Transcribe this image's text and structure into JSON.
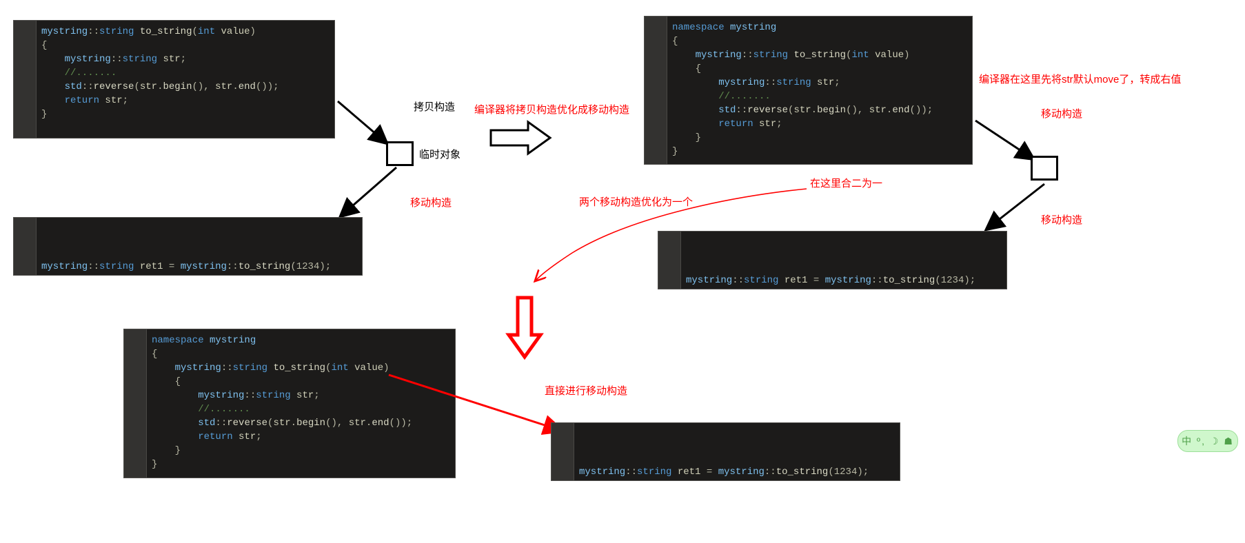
{
  "code_top_left": {
    "lines": [
      [
        {
          "t": "mystring",
          "c": "ns"
        },
        {
          "t": "::",
          "c": "pn"
        },
        {
          "t": "string",
          "c": "typ"
        },
        {
          "t": " ",
          "c": "pn"
        },
        {
          "t": "to_string",
          "c": "fn"
        },
        {
          "t": "(",
          "c": "pn"
        },
        {
          "t": "int",
          "c": "typ"
        },
        {
          "t": " value",
          "c": "var"
        },
        {
          "t": ")",
          "c": "pn"
        }
      ],
      [
        {
          "t": "{",
          "c": "pn"
        }
      ],
      [
        {
          "t": "    mystring",
          "c": "ns"
        },
        {
          "t": "::",
          "c": "pn"
        },
        {
          "t": "string",
          "c": "typ"
        },
        {
          "t": " str",
          "c": "var"
        },
        {
          "t": ";",
          "c": "pn"
        }
      ],
      [
        {
          "t": "    //.......",
          "c": "cm"
        }
      ],
      [
        {
          "t": "    std",
          "c": "ns"
        },
        {
          "t": "::",
          "c": "pn"
        },
        {
          "t": "reverse",
          "c": "fn"
        },
        {
          "t": "(",
          "c": "pn"
        },
        {
          "t": "str",
          "c": "var"
        },
        {
          "t": ".",
          "c": "pn"
        },
        {
          "t": "begin",
          "c": "fn"
        },
        {
          "t": "(), ",
          "c": "pn"
        },
        {
          "t": "str",
          "c": "var"
        },
        {
          "t": ".",
          "c": "pn"
        },
        {
          "t": "end",
          "c": "fn"
        },
        {
          "t": "());",
          "c": "pn"
        }
      ],
      [
        {
          "t": "    return",
          "c": "kw"
        },
        {
          "t": " str",
          "c": "var"
        },
        {
          "t": ";",
          "c": "pn"
        }
      ],
      [
        {
          "t": "}",
          "c": "pn"
        }
      ]
    ]
  },
  "code_top_right": {
    "lines": [
      [
        {
          "t": "namespace",
          "c": "kw"
        },
        {
          "t": " mystring",
          "c": "ns"
        }
      ],
      [
        {
          "t": "{",
          "c": "pn"
        }
      ],
      [
        {
          "t": "    mystring",
          "c": "ns"
        },
        {
          "t": "::",
          "c": "pn"
        },
        {
          "t": "string",
          "c": "typ"
        },
        {
          "t": " ",
          "c": "pn"
        },
        {
          "t": "to_string",
          "c": "fn"
        },
        {
          "t": "(",
          "c": "pn"
        },
        {
          "t": "int",
          "c": "typ"
        },
        {
          "t": " value",
          "c": "var"
        },
        {
          "t": ")",
          "c": "pn"
        }
      ],
      [
        {
          "t": "    {",
          "c": "pn"
        }
      ],
      [
        {
          "t": "        mystring",
          "c": "ns"
        },
        {
          "t": "::",
          "c": "pn"
        },
        {
          "t": "string",
          "c": "typ"
        },
        {
          "t": " str",
          "c": "var"
        },
        {
          "t": ";",
          "c": "pn"
        }
      ],
      [
        {
          "t": "        //.......",
          "c": "cm"
        }
      ],
      [
        {
          "t": "        std",
          "c": "ns"
        },
        {
          "t": "::",
          "c": "pn"
        },
        {
          "t": "reverse",
          "c": "fn"
        },
        {
          "t": "(",
          "c": "pn"
        },
        {
          "t": "str",
          "c": "var"
        },
        {
          "t": ".",
          "c": "pn"
        },
        {
          "t": "begin",
          "c": "fn"
        },
        {
          "t": "(), ",
          "c": "pn"
        },
        {
          "t": "str",
          "c": "var"
        },
        {
          "t": ".",
          "c": "pn"
        },
        {
          "t": "end",
          "c": "fn"
        },
        {
          "t": "());",
          "c": "pn"
        }
      ],
      [
        {
          "t": "        return",
          "c": "kw"
        },
        {
          "t": " str",
          "c": "var"
        },
        {
          "t": ";",
          "c": "pn"
        }
      ],
      [
        {
          "t": "    }",
          "c": "pn"
        }
      ],
      [
        {
          "t": "}",
          "c": "pn"
        }
      ]
    ]
  },
  "code_bottom_left": {
    "lines": [
      [
        {
          "t": "namespace",
          "c": "kw"
        },
        {
          "t": " mystring",
          "c": "ns"
        }
      ],
      [
        {
          "t": "{",
          "c": "pn"
        }
      ],
      [
        {
          "t": "    mystring",
          "c": "ns"
        },
        {
          "t": "::",
          "c": "pn"
        },
        {
          "t": "string",
          "c": "typ"
        },
        {
          "t": " ",
          "c": "pn"
        },
        {
          "t": "to_string",
          "c": "fn"
        },
        {
          "t": "(",
          "c": "pn"
        },
        {
          "t": "int",
          "c": "typ"
        },
        {
          "t": " value",
          "c": "var"
        },
        {
          "t": ")",
          "c": "pn"
        }
      ],
      [
        {
          "t": "    {",
          "c": "pn"
        }
      ],
      [
        {
          "t": "        mystring",
          "c": "ns"
        },
        {
          "t": "::",
          "c": "pn"
        },
        {
          "t": "string",
          "c": "typ"
        },
        {
          "t": " str",
          "c": "var"
        },
        {
          "t": ";",
          "c": "pn"
        }
      ],
      [
        {
          "t": "        //.......",
          "c": "cm"
        }
      ],
      [
        {
          "t": "        std",
          "c": "ns"
        },
        {
          "t": "::",
          "c": "pn"
        },
        {
          "t": "reverse",
          "c": "fn"
        },
        {
          "t": "(",
          "c": "pn"
        },
        {
          "t": "str",
          "c": "var"
        },
        {
          "t": ".",
          "c": "pn"
        },
        {
          "t": "begin",
          "c": "fn"
        },
        {
          "t": "(), ",
          "c": "pn"
        },
        {
          "t": "str",
          "c": "var"
        },
        {
          "t": ".",
          "c": "pn"
        },
        {
          "t": "end",
          "c": "fn"
        },
        {
          "t": "());",
          "c": "pn"
        }
      ],
      [
        {
          "t": "        return",
          "c": "kw"
        },
        {
          "t": " str",
          "c": "var"
        },
        {
          "t": ";",
          "c": "pn"
        }
      ],
      [
        {
          "t": "    }",
          "c": "pn"
        }
      ],
      [
        {
          "t": "}",
          "c": "pn"
        }
      ]
    ]
  },
  "ret_line": {
    "tokens": [
      {
        "t": "mystring",
        "c": "ns"
      },
      {
        "t": "::",
        "c": "pn"
      },
      {
        "t": "string",
        "c": "typ"
      },
      {
        "t": " ret1",
        "c": "var"
      },
      {
        "t": " = ",
        "c": "pn"
      },
      {
        "t": "mystring",
        "c": "ns"
      },
      {
        "t": "::",
        "c": "pn"
      },
      {
        "t": "to_string",
        "c": "fn"
      },
      {
        "t": "(",
        "c": "pn"
      },
      {
        "t": "1234",
        "c": "num"
      },
      {
        "t": ");",
        "c": "pn"
      }
    ]
  },
  "labels": {
    "copy_construct": "拷贝构造",
    "temp_object": "临时对象",
    "move_construct_left": "移动构造",
    "opt_to_move": "编译器将拷贝构造优化成移动构造",
    "default_move_note": "编译器在这里先将str默认move了，转成右值",
    "move_construct_r1": "移动构造",
    "merge_here": "在这里合二为一",
    "move_construct_r2": "移动构造",
    "two_to_one": "两个移动构造优化为一个",
    "direct_move": "直接进行移动构造"
  },
  "ime": "中 º, ☽ ☗"
}
